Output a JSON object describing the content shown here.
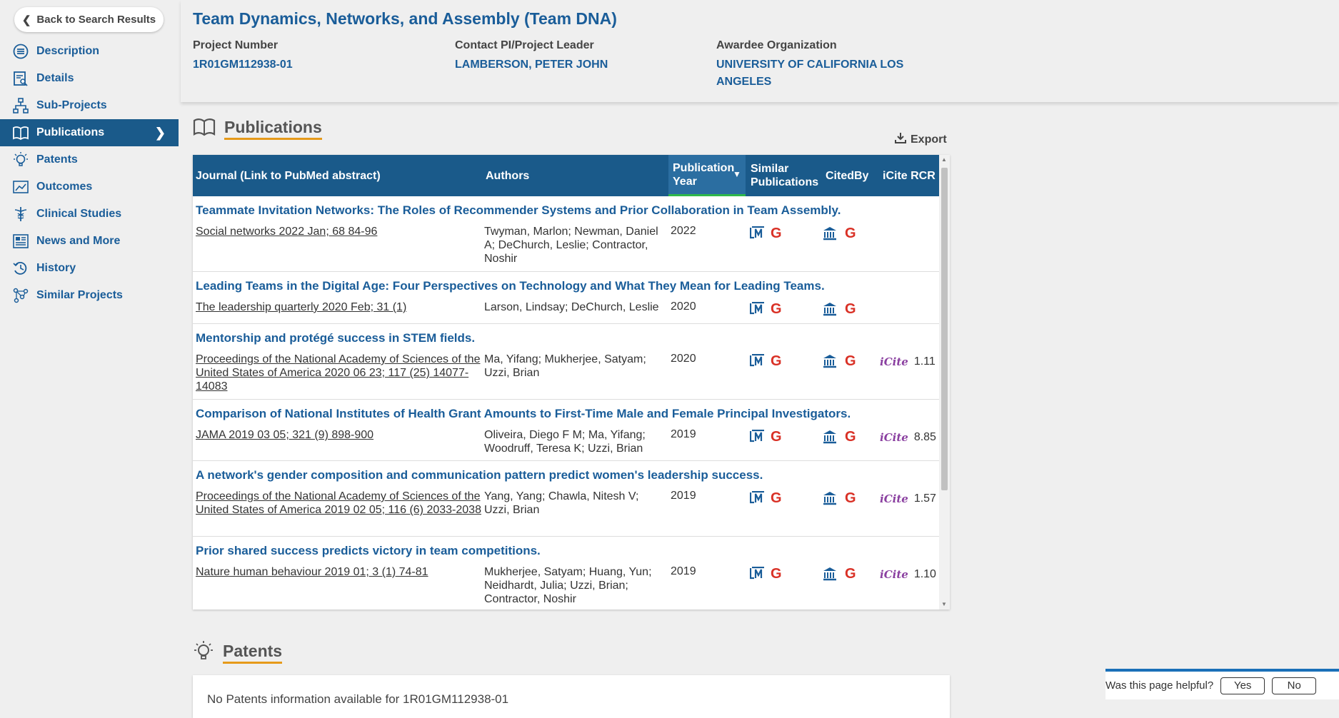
{
  "back_label": "Back to Search Results",
  "nav": [
    {
      "label": "Description",
      "icon": "list-circle-icon"
    },
    {
      "label": "Details",
      "icon": "document-search-icon"
    },
    {
      "label": "Sub-Projects",
      "icon": "hierarchy-icon"
    },
    {
      "label": "Publications",
      "icon": "book-icon",
      "active": true
    },
    {
      "label": "Patents",
      "icon": "lightbulb-icon"
    },
    {
      "label": "Outcomes",
      "icon": "chart-icon"
    },
    {
      "label": "Clinical Studies",
      "icon": "caduceus-icon"
    },
    {
      "label": "News and More",
      "icon": "newspaper-icon"
    },
    {
      "label": "History",
      "icon": "history-icon"
    },
    {
      "label": "Similar Projects",
      "icon": "network-icon"
    }
  ],
  "project": {
    "title": "Team Dynamics, Networks, and Assembly (Team DNA)",
    "number_label": "Project Number",
    "number": "1R01GM112938-01",
    "pi_label": "Contact PI/Project Leader",
    "pi": "LAMBERSON, PETER JOHN",
    "org_label": "Awardee Organization",
    "org": "UNIVERSITY OF CALIFORNIA LOS ANGELES"
  },
  "publications": {
    "title": "Publications",
    "export_label": "Export",
    "headers": {
      "journal": "Journal (Link to PubMed abstract)",
      "authors": "Authors",
      "year": "Publication Year",
      "similar": "Similar Publications",
      "citedby": "CitedBy",
      "icite": "iCite RCR"
    },
    "rows": [
      {
        "title": "Teammate Invitation Networks: The Roles of Recommender Systems and Prior Collaboration in Team Assembly.",
        "journal": "Social networks 2022 Jan; 68 84-96",
        "authors": "Twyman, Marlon; Newman, Daniel A; DeChurch, Leslie; Contractor, Noshir",
        "year": "2022",
        "rcr": ""
      },
      {
        "title": "Leading Teams in the Digital Age: Four Perspectives on Technology and What They Mean for Leading Teams.",
        "journal": "The leadership quarterly 2020 Feb; 31 (1)",
        "authors": "Larson, Lindsay; DeChurch, Leslie",
        "year": "2020",
        "rcr": ""
      },
      {
        "title": "Mentorship and protégé success in STEM fields.",
        "journal": "Proceedings of the National Academy of Sciences of the United States of America 2020 06 23; 117 (25) 14077-14083",
        "authors": "Ma, Yifang; Mukherjee, Satyam; Uzzi, Brian",
        "year": "2020",
        "rcr": "1.11"
      },
      {
        "title": "Comparison of National Institutes of Health Grant Amounts to First-Time Male and Female Principal Investigators.",
        "journal": "JAMA 2019 03 05; 321 (9) 898-900",
        "authors": "Oliveira, Diego F M; Ma, Yifang; Woodruff, Teresa K; Uzzi, Brian",
        "year": "2019",
        "rcr": "8.85"
      },
      {
        "title": "A network's gender composition and communication pattern predict women's leadership success.",
        "journal": "Proceedings of the National Academy of Sciences of the United States of America 2019 02 05; 116 (6) 2033-2038",
        "authors": "Yang, Yang; Chawla, Nitesh V; Uzzi, Brian",
        "year": "2019",
        "rcr": "1.57"
      },
      {
        "title": "Prior shared success predicts victory in team competitions.",
        "journal": "Nature human behaviour 2019 01; 3 (1) 74-81",
        "authors": "Mukherjee, Satyam; Huang, Yun; Neidhardt, Julia; Uzzi, Brian; Contractor, Noshir",
        "year": "2019",
        "rcr": "1.10"
      }
    ],
    "icite_logo": "iCite",
    "google_glyph": "G"
  },
  "patents": {
    "title": "Patents",
    "empty_text": "No Patents information available for 1R01GM112938-01"
  },
  "helpful": {
    "question": "Was this page helpful?",
    "yes": "Yes",
    "no": "No"
  },
  "colors": {
    "brand": "#1a5d99",
    "accent": "#e69a1a",
    "header_bg": "#1a5a8a"
  }
}
